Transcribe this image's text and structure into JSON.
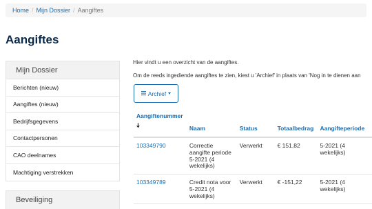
{
  "breadcrumb": {
    "items": [
      "Home",
      "Mijn Dossier"
    ],
    "current": "Aangiftes"
  },
  "page_title": "Aangiftes",
  "sidebar": {
    "title": "Mijn Dossier",
    "items": [
      {
        "label": "Berichten (nieuw)"
      },
      {
        "label": "Aangiftes (nieuw)"
      },
      {
        "label": "Bedrijfsgegevens"
      },
      {
        "label": "Contactpersonen"
      },
      {
        "label": "CAO deelnames"
      },
      {
        "label": "Machtiging verstrekken"
      }
    ]
  },
  "sidebar2": {
    "title": "Beveiliging"
  },
  "content": {
    "intro1": "Hier vindt u een overzicht van de aangiftes.",
    "intro2": "Om de reeds ingediende aangiftes te zien, kiest u 'Archief' in plaats van 'Nog in te dienen aan",
    "archive_button": "Archief",
    "table": {
      "headers": {
        "nummer": "Aangiftenummer",
        "naam": "Naam",
        "status": "Status",
        "totaal": "Totaalbedrag",
        "periode": "Aangifteperiode"
      },
      "rows": [
        {
          "nummer": "103349790",
          "naam": "Correctie aangifte periode 5-2021 (4 wekelijks)",
          "status": "Verwerkt",
          "totaal": "€ 151,82",
          "periode": "5-2021 (4 wekelijks)"
        },
        {
          "nummer": "103349789",
          "naam": "Credit nota voor 5-2021 (4 wekelijks)",
          "status": "Verwerkt",
          "totaal": "€ -151,22",
          "periode": "5-2021 (4 wekelijks)"
        }
      ]
    }
  },
  "colors": {
    "link": "#1a6cb0",
    "title": "#0b2a4a"
  },
  "icons": {
    "archive": "list-icon",
    "dropdown": "caret-down-icon",
    "sort": "sort-down-arrow-icon"
  }
}
